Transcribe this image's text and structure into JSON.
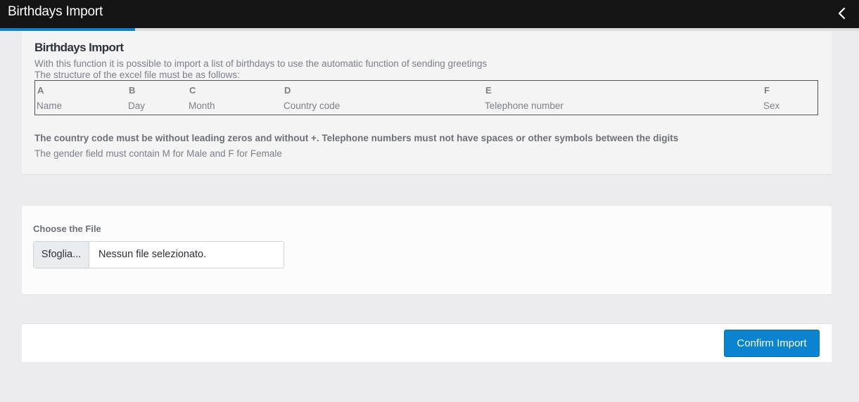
{
  "header": {
    "title": "Birthdays Import",
    "back_icon": "chevron-left-icon"
  },
  "info": {
    "title": "Birthdays Import",
    "description_line1": "With this function it is possible to import a list of birthdays to use the automatic function of sending greetings",
    "description_line2": "The structure of the excel file must be as follows:",
    "columns": [
      {
        "letter": "A",
        "field": "Name"
      },
      {
        "letter": "B",
        "field": "Day"
      },
      {
        "letter": "C",
        "field": "Month"
      },
      {
        "letter": "D",
        "field": "Country code"
      },
      {
        "letter": "E",
        "field": "Telephone number"
      },
      {
        "letter": "F",
        "field": "Sex"
      }
    ],
    "note_bold": "The country code must be without leading zeros and without +. Telephone numbers must not have spaces or other symbols between the digits",
    "note": "The gender field must contain M for Male and F for Female"
  },
  "file_section": {
    "label": "Choose the File",
    "browse_label": "Sfoglia...",
    "filename": "Nessun file selezionato."
  },
  "actions": {
    "confirm_label": "Confirm Import"
  },
  "colors": {
    "accent": "#0a84d0",
    "topbar": "#141414",
    "background": "#ececef"
  }
}
